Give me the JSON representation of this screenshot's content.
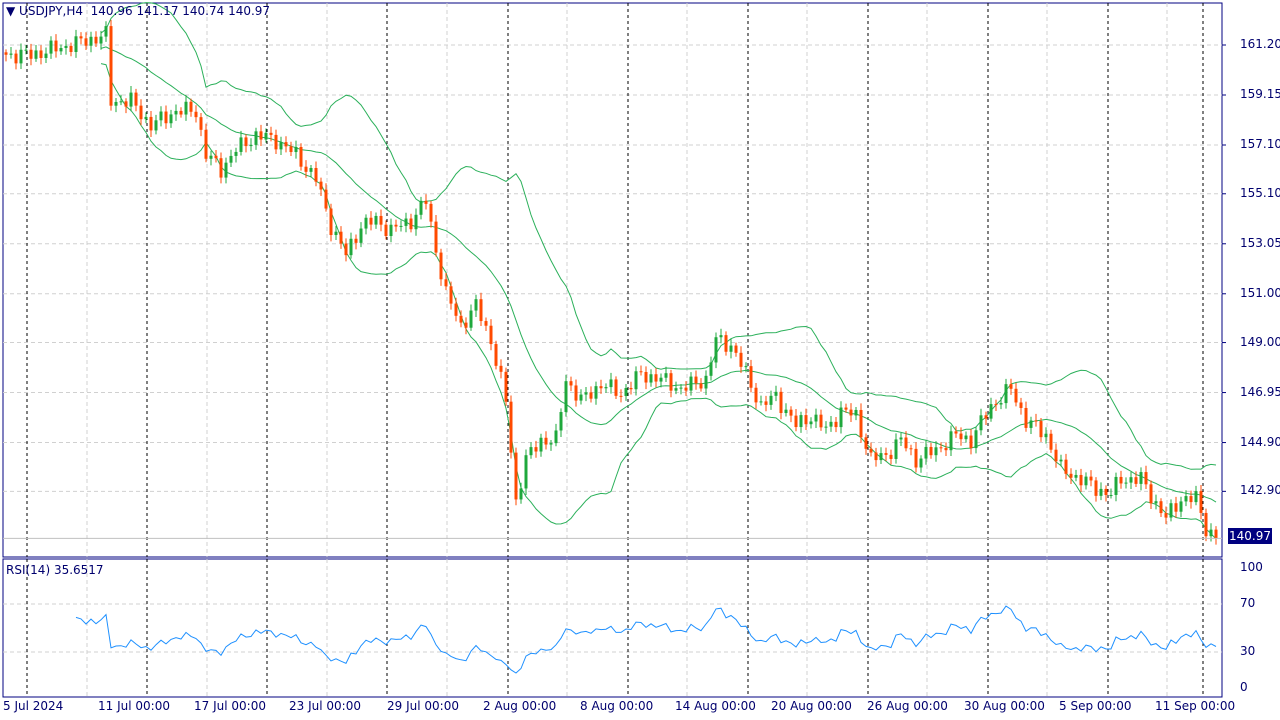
{
  "header": {
    "symbol": "USDJPY,H4",
    "ohlc": "140.96 141.17 140.74 140.97"
  },
  "current_price": "140.97",
  "rsi_label": "RSI(14) 35.6517",
  "colors": {
    "frame": "#000080",
    "bull": "#1fa83c",
    "bear": "#ff4a00",
    "bands": "#2bb05a",
    "rsi": "#1e90ff",
    "grid": "#d0d0d0"
  },
  "chart_data": {
    "type": "candlestick",
    "title": "USDJPY,H4",
    "price_ticks": [
      "161.20",
      "159.15",
      "157.10",
      "155.10",
      "153.05",
      "151.00",
      "149.00",
      "146.95",
      "144.90",
      "142.90"
    ],
    "price_range": [
      140.2,
      162.9
    ],
    "rsi_ticks": [
      "100",
      "70",
      "30",
      "0"
    ],
    "rsi_levels": [
      30,
      70
    ],
    "x_labels": [
      "5 Jul 2024",
      "11 Jul 00:00",
      "17 Jul 00:00",
      "23 Jul 00:00",
      "29 Jul 00:00",
      "2 Aug 00:00",
      "8 Aug 00:00",
      "14 Aug 00:00",
      "20 Aug 00:00",
      "26 Aug 00:00",
      "30 Aug 00:00",
      "5 Sep 00:00",
      "11 Sep 00:00"
    ],
    "bar_count": 243,
    "indicators": [
      "Bollinger Bands(20,2)",
      "RSI(14)"
    ],
    "close_anchors": [
      [
        0,
        160.8
      ],
      [
        5,
        160.8
      ],
      [
        11,
        161.1
      ],
      [
        20,
        161.6
      ],
      [
        21,
        158.9
      ],
      [
        25,
        158.9
      ],
      [
        29,
        157.9
      ],
      [
        34,
        158.5
      ],
      [
        38,
        158.5
      ],
      [
        40,
        156.7
      ],
      [
        43,
        156.1
      ],
      [
        46,
        156.9
      ],
      [
        50,
        157.5
      ],
      [
        54,
        157.3
      ],
      [
        58,
        156.7
      ],
      [
        62,
        155.7
      ],
      [
        65,
        153.8
      ],
      [
        68,
        152.6
      ],
      [
        71,
        153.8
      ],
      [
        74,
        154.0
      ],
      [
        77,
        153.6
      ],
      [
        81,
        154.0
      ],
      [
        84,
        154.8
      ],
      [
        86,
        152.8
      ],
      [
        88,
        151.0
      ],
      [
        91,
        149.7
      ],
      [
        94,
        150.5
      ],
      [
        97,
        149.1
      ],
      [
        100,
        146.6
      ],
      [
        102,
        142.5
      ],
      [
        104,
        144.2
      ],
      [
        107,
        145.0
      ],
      [
        110,
        145.0
      ],
      [
        112,
        147.5
      ],
      [
        115,
        146.6
      ],
      [
        119,
        147.3
      ],
      [
        123,
        146.9
      ],
      [
        127,
        147.7
      ],
      [
        131,
        147.5
      ],
      [
        135,
        147.1
      ],
      [
        140,
        147.5
      ],
      [
        142,
        149.1
      ],
      [
        145,
        148.9
      ],
      [
        148,
        147.7
      ],
      [
        151,
        146.4
      ],
      [
        154,
        146.8
      ],
      [
        158,
        145.6
      ],
      [
        161,
        146.0
      ],
      [
        164,
        145.4
      ],
      [
        167,
        146.2
      ],
      [
        170,
        146.0
      ],
      [
        173,
        144.2
      ],
      [
        176,
        144.4
      ],
      [
        179,
        145.0
      ],
      [
        182,
        144.2
      ],
      [
        186,
        144.6
      ],
      [
        190,
        145.2
      ],
      [
        193,
        145.0
      ],
      [
        197,
        146.4
      ],
      [
        201,
        147.1
      ],
      [
        204,
        145.8
      ],
      [
        208,
        145.2
      ],
      [
        211,
        143.8
      ],
      [
        215,
        143.4
      ],
      [
        218,
        143.0
      ],
      [
        221,
        142.8
      ],
      [
        223,
        143.4
      ],
      [
        227,
        143.4
      ],
      [
        230,
        142.4
      ],
      [
        232,
        141.8
      ],
      [
        235,
        142.6
      ],
      [
        238,
        142.6
      ],
      [
        240,
        141.4
      ],
      [
        242,
        140.97
      ]
    ]
  }
}
